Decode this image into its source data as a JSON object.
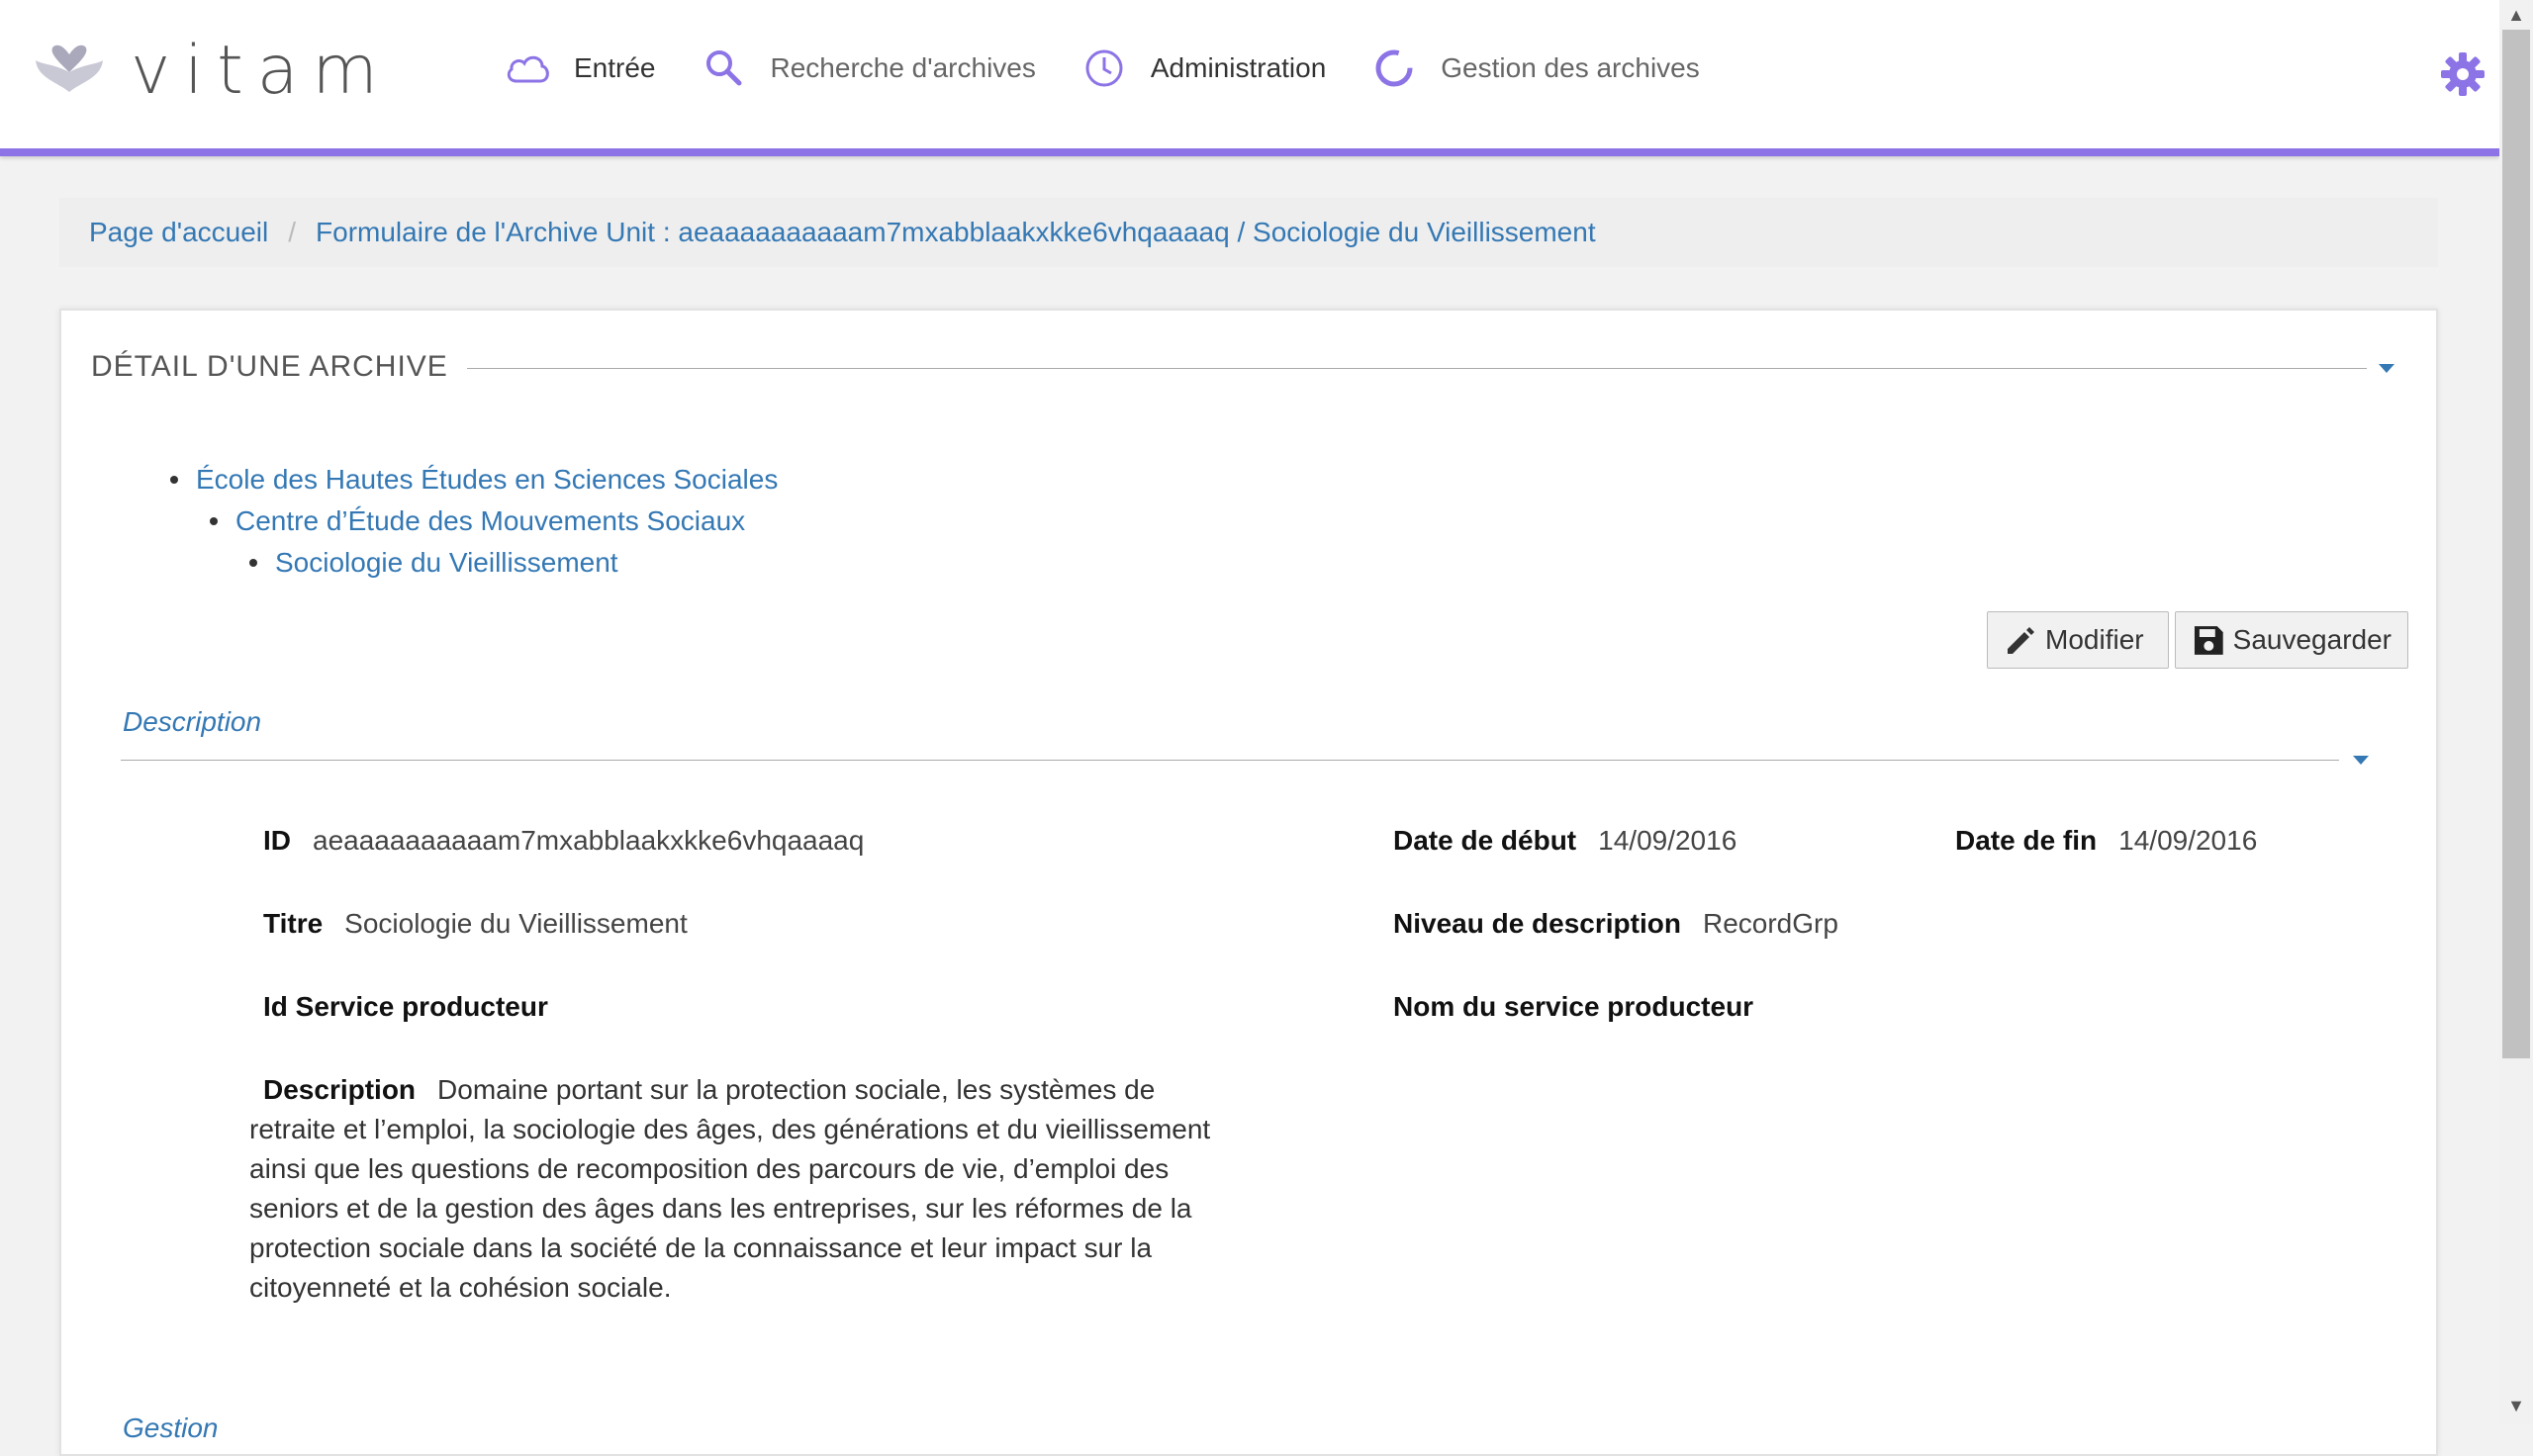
{
  "header": {
    "logo_text": "vitam",
    "nav": [
      {
        "label": "Entrée",
        "icon": "cloud-icon"
      },
      {
        "label": "Recherche d'archives",
        "icon": "search-icon"
      },
      {
        "label": "Administration",
        "icon": "clock-icon"
      },
      {
        "label": "Gestion des archives",
        "icon": "loading-ring-icon"
      }
    ],
    "settings_icon": "gear-icon",
    "accent_color": "#8c74e6"
  },
  "breadcrumb": {
    "home": "Page d'accueil",
    "separator": "/",
    "current": "Formulaire de l'Archive Unit : aeaaaaaaaaaam7mxabblaakxkke6vhqaaaaq / Sociologie du Vieillissement"
  },
  "panel": {
    "title": "DÉTAIL D'UNE ARCHIVE",
    "tree": [
      "École des Hautes Études en Sciences Sociales",
      "Centre d’Étude des Mouvements Sociaux",
      "Sociologie du Vieillissement"
    ],
    "buttons": {
      "modify": "Modifier",
      "save": "Sauvegarder"
    },
    "section_title": "Description",
    "fields": {
      "id_label": "ID",
      "id_value": "aeaaaaaaaaaam7mxabblaakxkke6vhqaaaaq",
      "start_label": "Date de début",
      "start_value": "14/09/2016",
      "end_label": "Date de fin",
      "end_value": "14/09/2016",
      "title_label": "Titre",
      "title_value": "Sociologie du Vieillissement",
      "level_label": "Niveau de description",
      "level_value": "RecordGrp",
      "producer_id_label": "Id Service producteur",
      "producer_name_label": "Nom du service producteur",
      "description_label": "Description",
      "description_value": "Domaine portant sur la protection sociale, les systèmes de retraite et l’emploi, la sociologie des âges, des générations et du vieillissement ainsi que les questions de recomposition des parcours de vie, d’emploi des seniors et de la gestion des âges dans les entreprises, sur les réformes de la protection sociale dans la société de la connaissance et leur impact sur la citoyenneté et la cohésion sociale."
    },
    "next_section_title": "Gestion"
  }
}
